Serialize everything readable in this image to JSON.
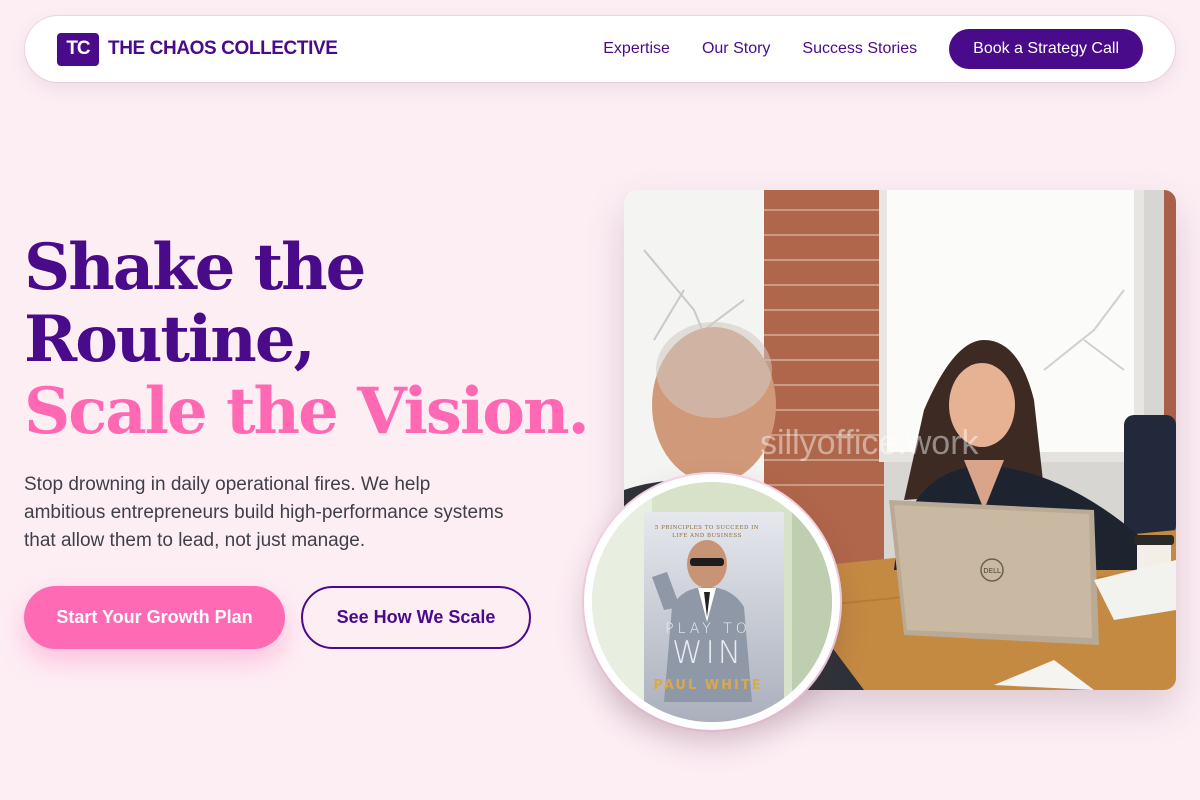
{
  "nav": {
    "logo_initials": "TC",
    "brand_name": "THE CHAOS COLLECTIVE",
    "links": [
      {
        "label": "Expertise"
      },
      {
        "label": "Our Story"
      },
      {
        "label": "Success Stories"
      }
    ],
    "cta_label": "Book a Strategy Call"
  },
  "hero": {
    "headline_line1": "Shake the",
    "headline_line2": "Routine,",
    "headline_line3": "Scale the Vision.",
    "subcopy": "Stop drowning in daily operational fires. We help ambitious entrepreneurs build high-performance systems that allow them to lead, not just manage.",
    "primary_cta": "Start Your Growth Plan",
    "secondary_cta": "See How We Scale"
  },
  "image": {
    "watermark": "sillyoffice.work",
    "laptop_brand": "DELL",
    "book": {
      "tagline": "5 PRINCIPLES TO SUCCEED IN LIFE AND BUSINESS",
      "title_small": "PLAY TO",
      "title_large": "WIN",
      "author": "PAUL WHITE"
    }
  },
  "colors": {
    "background": "#fdeef4",
    "brand_purple": "#4a0b8a",
    "accent_pink": "#ff69b4",
    "text_body": "#3f3f4a"
  }
}
